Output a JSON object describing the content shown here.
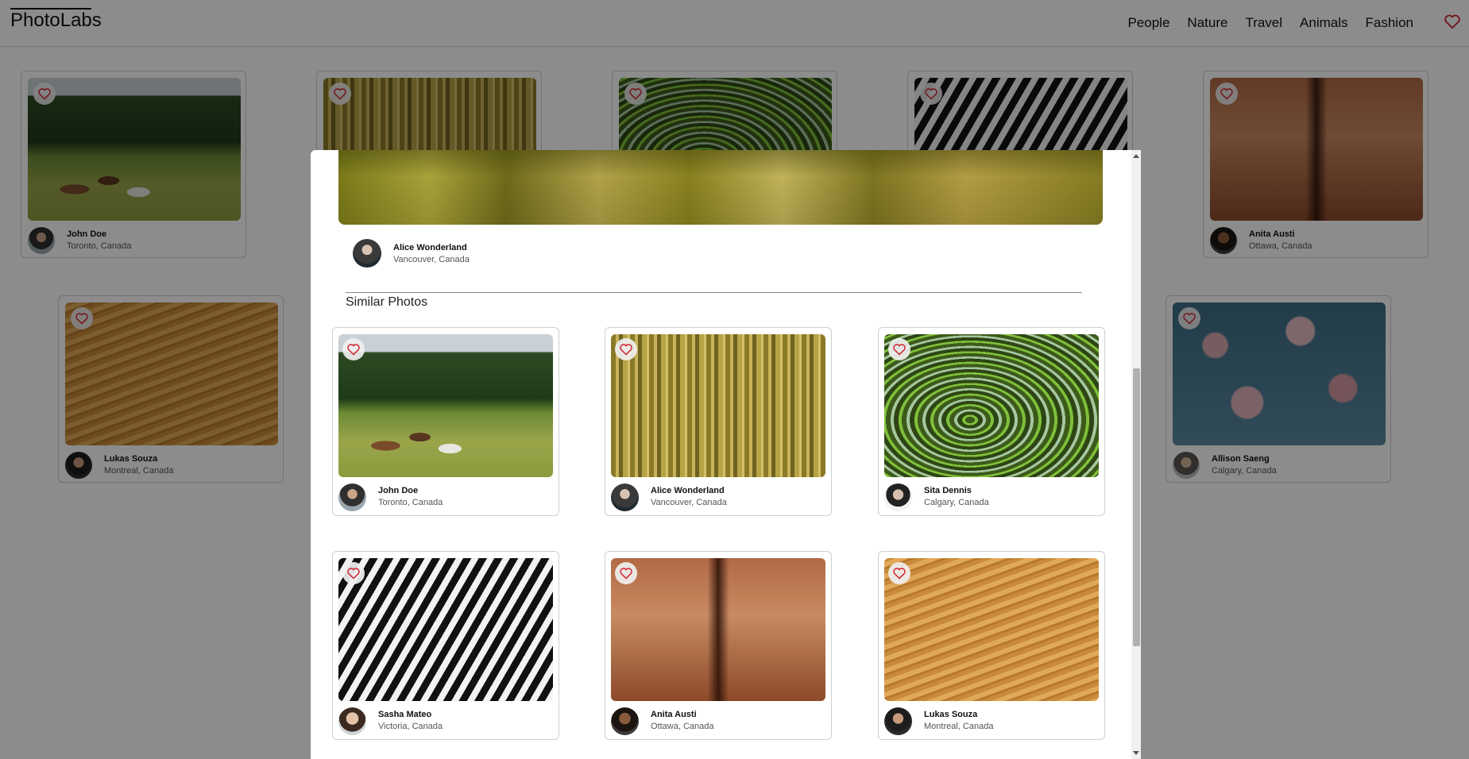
{
  "app": {
    "title": "PhotoLabs"
  },
  "nav": {
    "topics": [
      "People",
      "Nature",
      "Travel",
      "Animals",
      "Fashion"
    ]
  },
  "background_cards": [
    {
      "name": "John Doe",
      "location": "Toronto, Canada"
    },
    {
      "name": "Anita Austi",
      "location": "Ottawa, Canada"
    },
    {
      "name": "Lukas Souza",
      "location": "Montreal, Canada"
    },
    {
      "name": "Allison Saeng",
      "location": "Calgary, Canada"
    }
  ],
  "modal": {
    "author": {
      "name": "Alice Wonderland",
      "location": "Vancouver, Canada"
    },
    "similar_title": "Similar Photos",
    "similar": [
      {
        "name": "John Doe",
        "location": "Toronto, Canada"
      },
      {
        "name": "Alice Wonderland",
        "location": "Vancouver, Canada"
      },
      {
        "name": "Sita Dennis",
        "location": "Calgary, Canada"
      },
      {
        "name": "Sasha Mateo",
        "location": "Victoria, Canada"
      },
      {
        "name": "Anita Austi",
        "location": "Ottawa, Canada"
      },
      {
        "name": "Lukas Souza",
        "location": "Montreal, Canada"
      }
    ]
  },
  "colors": {
    "accent": "#d21f2d",
    "overlay": "#000000"
  },
  "icons": {
    "favourite": "heart-icon"
  }
}
